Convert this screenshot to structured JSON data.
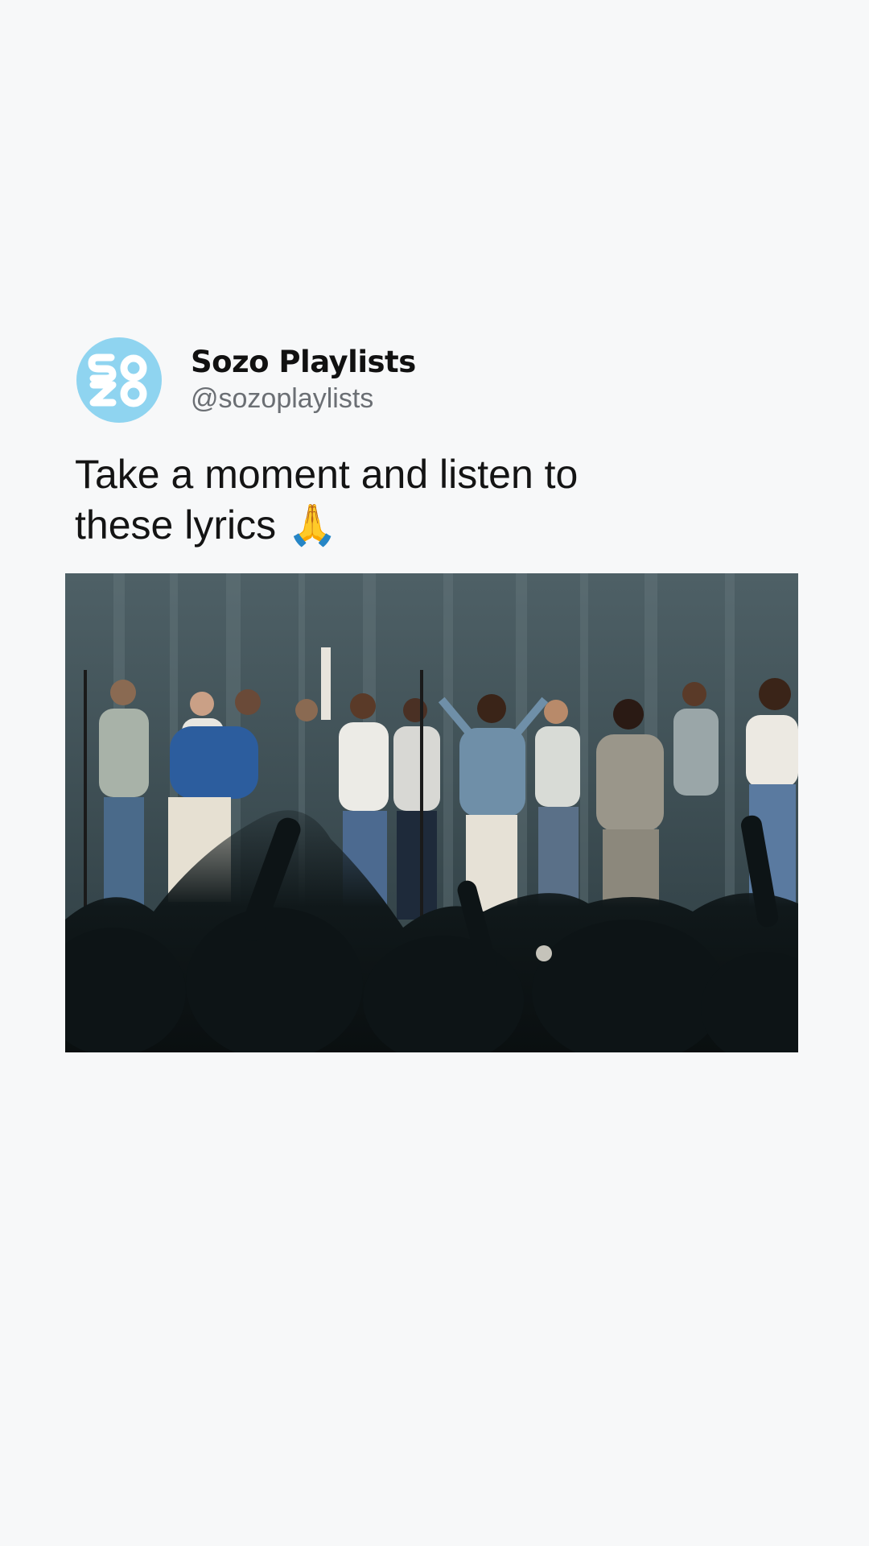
{
  "post": {
    "author": {
      "display_name": "Sozo Playlists",
      "handle": "@sozoplaylists",
      "avatar_icon": "sozo-logo-icon",
      "avatar_color": "#8fd4f0"
    },
    "text": "Take a moment and listen to these lyrics 🙏",
    "media": {
      "type": "video-frame",
      "description_icon": "worship-concert-photo"
    }
  },
  "colors": {
    "background": "#f7f8f9",
    "text": "#141414",
    "handle": "#6b6f74"
  }
}
